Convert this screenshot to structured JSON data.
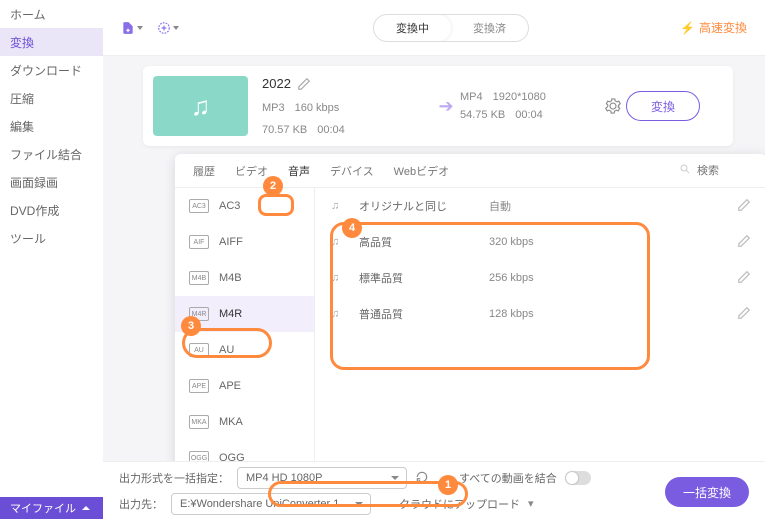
{
  "sidebar": {
    "items": [
      "ホーム",
      "変換",
      "ダウンロード",
      "圧縮",
      "編集",
      "ファイル結合",
      "画面録画",
      "DVD作成",
      "ツール"
    ],
    "active_index": 1,
    "footer": "マイファイル"
  },
  "topbar": {
    "segments": [
      "変換中",
      "変換済"
    ],
    "active_segment": 0,
    "fast_label": "高速変換"
  },
  "file": {
    "name": "2022",
    "input": {
      "format": "MP3",
      "bitrate": "160 kbps",
      "size": "70.57 KB",
      "duration": "00:04"
    },
    "output": {
      "format": "MP4",
      "resolution": "1920*1080",
      "size": "54.75 KB",
      "duration": "00:04"
    },
    "convert_label": "変換"
  },
  "panel": {
    "tabs": [
      "履歴",
      "ビデオ",
      "音声",
      "デバイス",
      "Webビデオ"
    ],
    "active_tab": 2,
    "search_placeholder": "検索",
    "formats": [
      "AC3",
      "AIFF",
      "M4B",
      "M4R",
      "AU",
      "APE",
      "MKA",
      "OGG"
    ],
    "active_format": 3,
    "qualities": [
      {
        "name": "オリジナルと同じ",
        "rate": "自動"
      },
      {
        "name": "高品質",
        "rate": "320 kbps"
      },
      {
        "name": "標準品質",
        "rate": "256 kbps"
      },
      {
        "name": "普通品質",
        "rate": "128 kbps"
      }
    ]
  },
  "bottom": {
    "format_label": "出力形式を一括指定：",
    "format_value": "MP4 HD 1080P",
    "output_label": "出力先：",
    "output_value": "E:¥Wondershare UniConverter 1",
    "merge_label": "すべての動画を結合",
    "cloud_label": "クラウドにアップロード",
    "batch_label": "一括変換"
  },
  "annotations": {
    "1": "1",
    "2": "2",
    "3": "3",
    "4": "4"
  }
}
